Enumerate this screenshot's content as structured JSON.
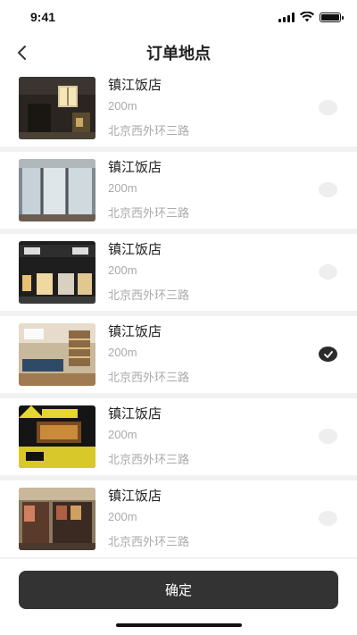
{
  "status_bar": {
    "time": "9:41"
  },
  "nav": {
    "title": "订单地点"
  },
  "locations": [
    {
      "name": "镇江饭店",
      "distance": "200m",
      "address": "北京西外环三路",
      "selected": false
    },
    {
      "name": "镇江饭店",
      "distance": "200m",
      "address": "北京西外环三路",
      "selected": false
    },
    {
      "name": "镇江饭店",
      "distance": "200m",
      "address": "北京西外环三路",
      "selected": false
    },
    {
      "name": "镇江饭店",
      "distance": "200m",
      "address": "北京西外环三路",
      "selected": true
    },
    {
      "name": "镇江饭店",
      "distance": "200m",
      "address": "北京西外环三路",
      "selected": false
    },
    {
      "name": "镇江饭店",
      "distance": "200m",
      "address": "北京西外环三路",
      "selected": false
    }
  ],
  "footer": {
    "confirm_label": "确定"
  },
  "colors": {
    "primary": "#333333",
    "radio_unchecked": "#eeeeee",
    "secondary_text": "#aaaaaa"
  }
}
